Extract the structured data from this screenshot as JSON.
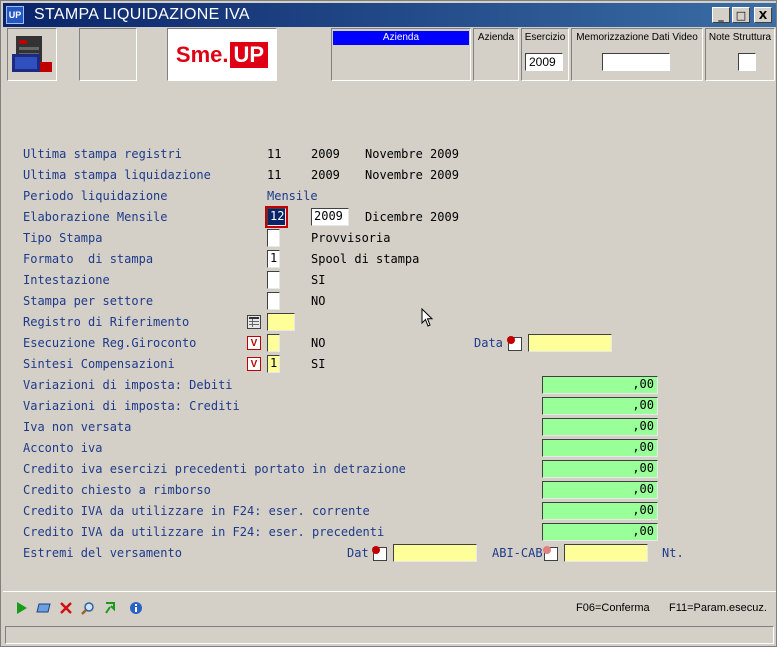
{
  "window": {
    "icon_text": "UP",
    "title": "STAMPA LIQUIDAZIONE IVA",
    "buttons": {
      "minimize": "_",
      "maximize": "□",
      "close": "X"
    }
  },
  "header": {
    "logo_sme": "Sme.",
    "logo_up": "UP",
    "columns": {
      "azienda_selected": "Azienda",
      "azienda": "Azienda",
      "esercizio": "Esercizio",
      "memorizzazione": "Memorizzazione Dati Video",
      "note": "Note Struttura"
    },
    "esercizio_value": "2009",
    "memorizzazione_value": "",
    "note_value": ""
  },
  "form": {
    "ultima_stampa_registri": {
      "label": "Ultima stampa registri",
      "month": "11",
      "year": "2009",
      "text": "Novembre 2009"
    },
    "ultima_stampa_liquidazione": {
      "label": "Ultima stampa liquidazione",
      "month": "11",
      "year": "2009",
      "text": "Novembre 2009"
    },
    "periodo_liquidazione": {
      "label": "Periodo liquidazione",
      "value": "Mensile"
    },
    "elaborazione_mensile": {
      "label": "Elaborazione Mensile",
      "month": "12",
      "year": "2009",
      "text": "Dicembre 2009"
    },
    "tipo_stampa": {
      "label": "Tipo Stampa",
      "value": "",
      "text": "Provvisoria"
    },
    "formato_stampa": {
      "label": "Formato  di stampa",
      "value": "1",
      "text": "Spool di stampa"
    },
    "intestazione": {
      "label": "Intestazione",
      "value": "",
      "text": "SI"
    },
    "stampa_settore": {
      "label": "Stampa per settore",
      "value": "",
      "text": "NO"
    },
    "registro_riferimento": {
      "label": "Registro di Riferimento",
      "value": ""
    },
    "esecuzione_giroconto": {
      "label": "Esecuzione Reg.Giroconto",
      "value": "",
      "text": "NO",
      "data_label": "Data",
      "data_value": ""
    },
    "sintesi_compensazioni": {
      "label": "Sintesi Compensazioni",
      "value": "1",
      "text": "SI"
    },
    "variazioni_debiti": {
      "label": "Variazioni di imposta: Debiti",
      "value": ",00"
    },
    "variazioni_crediti": {
      "label": "Variazioni di imposta: Crediti",
      "value": ",00"
    },
    "iva_non_versata": {
      "label": "Iva non versata",
      "value": ",00"
    },
    "acconto_iva": {
      "label": "Acconto iva",
      "value": ",00"
    },
    "credito_precedenti": {
      "label": "Credito iva esercizi precedenti portato in detrazione",
      "value": ",00"
    },
    "credito_rimborso": {
      "label": "Credito chiesto a rimborso",
      "value": ",00"
    },
    "credito_f24_corrente": {
      "label": "Credito IVA da utilizzare in F24: eser. corrente",
      "value": ",00"
    },
    "credito_f24_precedenti": {
      "label": "Credito IVA da utilizzare in F24: eser. precedenti",
      "value": ",00"
    },
    "estremi_versamento": {
      "label": "Estremi del versamento",
      "dat_label": "Dat",
      "dat_value": "",
      "abicab_label": "ABI-CAB",
      "abicab_value": "",
      "nt_label": "Nt."
    }
  },
  "toolbar": {
    "fkeys": {
      "f06": "F06=Conferma",
      "f11": "F11=Param.esecuz."
    }
  },
  "colors": {
    "title_start": "#0a246a",
    "yellow_field": "#ffff99",
    "green_field": "#99ff99",
    "label_blue": "#1e3a8a"
  }
}
